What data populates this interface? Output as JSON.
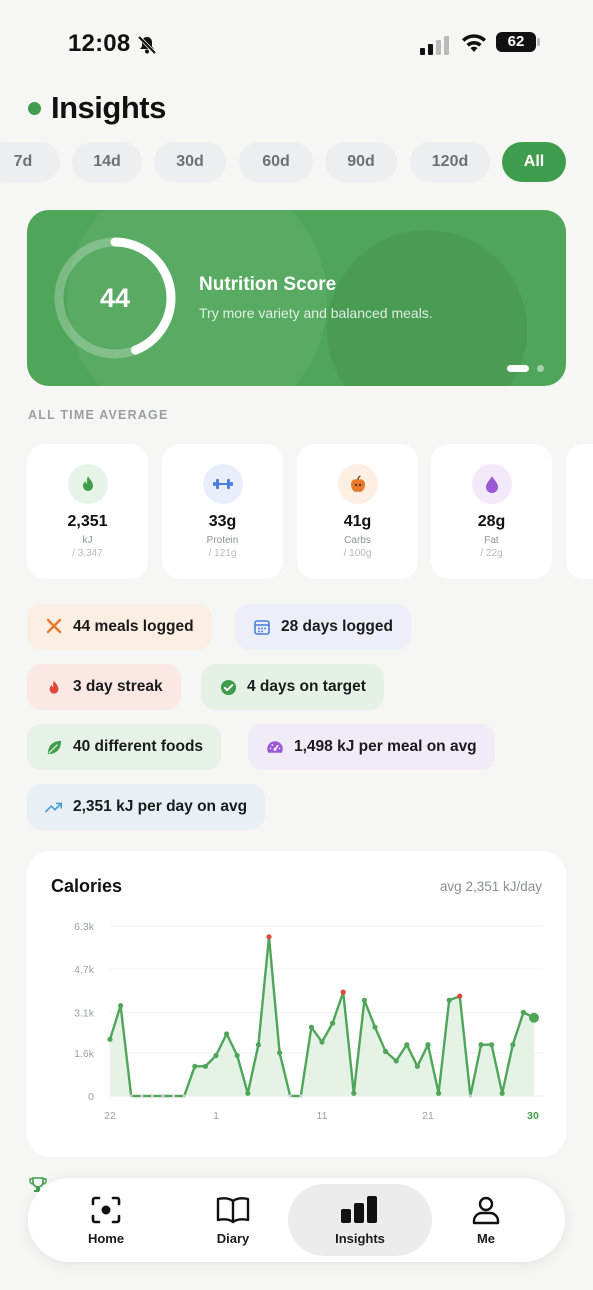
{
  "status_bar": {
    "time": "12:08",
    "battery": "62"
  },
  "header": {
    "title": "Insights"
  },
  "ranges": [
    "7d",
    "14d",
    "30d",
    "60d",
    "90d",
    "120d",
    "All"
  ],
  "active_range": "All",
  "score_card": {
    "score": "44",
    "score_fraction": 0.44,
    "title": "Nutrition Score",
    "subtitle": "Try more variety and balanced meals."
  },
  "averages": {
    "section_label": "ALL TIME AVERAGE",
    "items": [
      {
        "icon": "flame-icon",
        "value": "2,351",
        "label": "kJ",
        "target": "/ 3,347",
        "color": "#3f9d4e",
        "bg": "#e6f4e8"
      },
      {
        "icon": "dumbbell-icon",
        "value": "33g",
        "label": "Protein",
        "target": "/ 121g",
        "color": "#4c7fe0",
        "bg": "#e8effb"
      },
      {
        "icon": "apple-icon",
        "value": "41g",
        "label": "Carbs",
        "target": "/ 100g",
        "color": "#e8782a",
        "bg": "#fdf0e3"
      },
      {
        "icon": "drop-icon",
        "value": "28g",
        "label": "Fat",
        "target": "/ 22g",
        "color": "#9b59d6",
        "bg": "#f2eafb"
      }
    ]
  },
  "stats": [
    {
      "icon": "utensils-icon",
      "text": "44 meals logged",
      "bg": "#fbeee3",
      "color": "#e8782a"
    },
    {
      "icon": "calendar-icon",
      "text": "28 days logged",
      "bg": "#eceff8",
      "color": "#4c7fe0"
    },
    {
      "icon": "flame-icon",
      "text": "3 day streak",
      "bg": "#fbe8e5",
      "color": "#e0483a"
    },
    {
      "icon": "check-circle-icon",
      "text": "4 days on target",
      "bg": "#e6f1e6",
      "color": "#3f9d4e"
    },
    {
      "icon": "leaf-icon",
      "text": "40 different foods",
      "bg": "#e6f1e8",
      "color": "#3f9d4e"
    },
    {
      "icon": "gauge-icon",
      "text": "1,498 kJ per meal on avg",
      "bg": "#f1eaf7",
      "color": "#9b59d6"
    },
    {
      "icon": "trend-up-icon",
      "text": "2,351 kJ per day on avg",
      "bg": "#e8f0f6",
      "color": "#4c9ad6"
    }
  ],
  "chart": {
    "title": "Calories",
    "avg_label": "avg 2,351 kJ/day"
  },
  "chart_data": {
    "type": "line",
    "title": "Calories",
    "y_ticks": [
      "6.3k",
      "4.7k",
      "3.1k",
      "1.6k",
      "0"
    ],
    "y_tick_values": [
      6300,
      4700,
      3100,
      1600,
      0
    ],
    "ylim": [
      0,
      6300
    ],
    "x_ticks": [
      "22",
      "1",
      "11",
      "21",
      "30"
    ],
    "x_tick_indices": [
      0,
      10,
      20,
      30,
      39
    ],
    "values": [
      2100,
      3350,
      0,
      0,
      0,
      0,
      0,
      0,
      1100,
      1100,
      1500,
      2300,
      1500,
      100,
      1900,
      5900,
      1600,
      0,
      0,
      2550,
      2000,
      2700,
      3850,
      100,
      3550,
      2550,
      1650,
      1300,
      1900,
      1100,
      1900,
      100,
      3550,
      3700,
      0,
      1900,
      1900,
      100,
      1900,
      3100,
      2900
    ],
    "over_target_indices": [
      15,
      22,
      33
    ],
    "colors": {
      "line": "#4fa55a",
      "fill": "#e5f2e6",
      "over": "#e0483a",
      "grid": "#efefef"
    }
  },
  "nav": [
    {
      "icon": "scan-icon",
      "label": "Home"
    },
    {
      "icon": "book-icon",
      "label": "Diary"
    },
    {
      "icon": "bar-chart-icon",
      "label": "Insights"
    },
    {
      "icon": "person-icon",
      "label": "Me"
    }
  ],
  "active_nav": "Insights"
}
